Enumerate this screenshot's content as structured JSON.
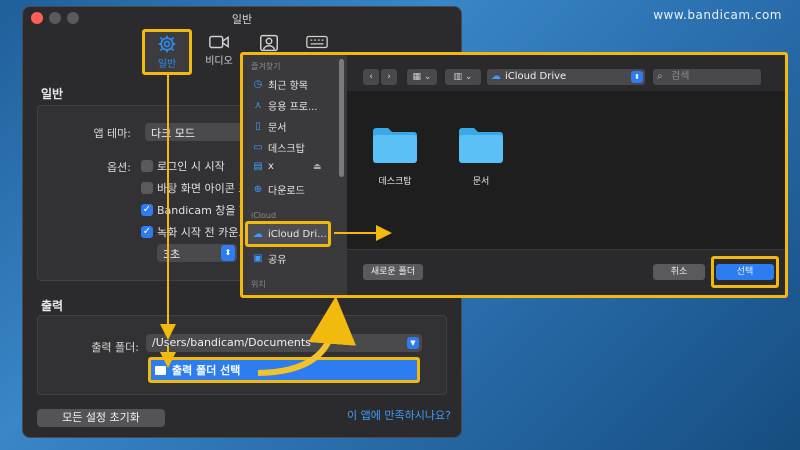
{
  "watermark": "www.bandicam.com",
  "window": {
    "title": "일반",
    "toolbar": [
      {
        "label": "일반",
        "icon": "gear-icon",
        "active": true
      },
      {
        "label": "비디오",
        "icon": "video-camera-icon"
      },
      {
        "label": "",
        "icon": "screenshot-icon"
      },
      {
        "label": "",
        "icon": "keyboard-icon"
      }
    ],
    "general": {
      "heading": "일반",
      "theme_label": "앱 테마:",
      "theme_value": "다크 모드",
      "options_label": "옵션:",
      "options": [
        {
          "label": "로그인 시 시작",
          "checked": false
        },
        {
          "label": "바탕 화면 아이콘 표",
          "checked": false
        },
        {
          "label": "Bandicam 창을 항",
          "checked": true
        },
        {
          "label": "녹화 시작 전 카운트",
          "checked": true
        }
      ],
      "countdown_value": "3초"
    },
    "output": {
      "heading": "출력",
      "folder_label": "출력 폴더:",
      "folder_path": "/Users/bandicam/Documents",
      "select_button": "출력 폴더 선택"
    },
    "reset_button": "모든 설정 초기화",
    "feedback_link": "이 앱에 만족하시나요?"
  },
  "dialog": {
    "sidebar": {
      "favorites_header": "즐겨찾기",
      "favorites": [
        {
          "label": "최근 항목",
          "icon": "clock-icon"
        },
        {
          "label": "응용 프로...",
          "icon": "apps-icon"
        },
        {
          "label": "문서",
          "icon": "document-icon"
        },
        {
          "label": "데스크탑",
          "icon": "desktop-icon"
        },
        {
          "label": "x",
          "icon": "drive-icon"
        },
        {
          "label": "다운로드",
          "icon": "download-icon"
        }
      ],
      "icloud_header": "iCloud",
      "icloud_items": [
        {
          "label": "iCloud Dri...",
          "icon": "cloud-icon",
          "selected": true
        },
        {
          "label": "공유",
          "icon": "shared-folder-icon"
        }
      ],
      "locations_header": "위치"
    },
    "location": "iCloud Drive",
    "search_placeholder": "검색",
    "folders": [
      "데스크탑",
      "문서"
    ],
    "new_folder_button": "새로운 폴더",
    "cancel_button": "취소",
    "choose_button": "선택"
  },
  "colors": {
    "accent": "#2d7cf0",
    "highlight": "#f2b90f",
    "window_bg": "#2b2b2d"
  }
}
